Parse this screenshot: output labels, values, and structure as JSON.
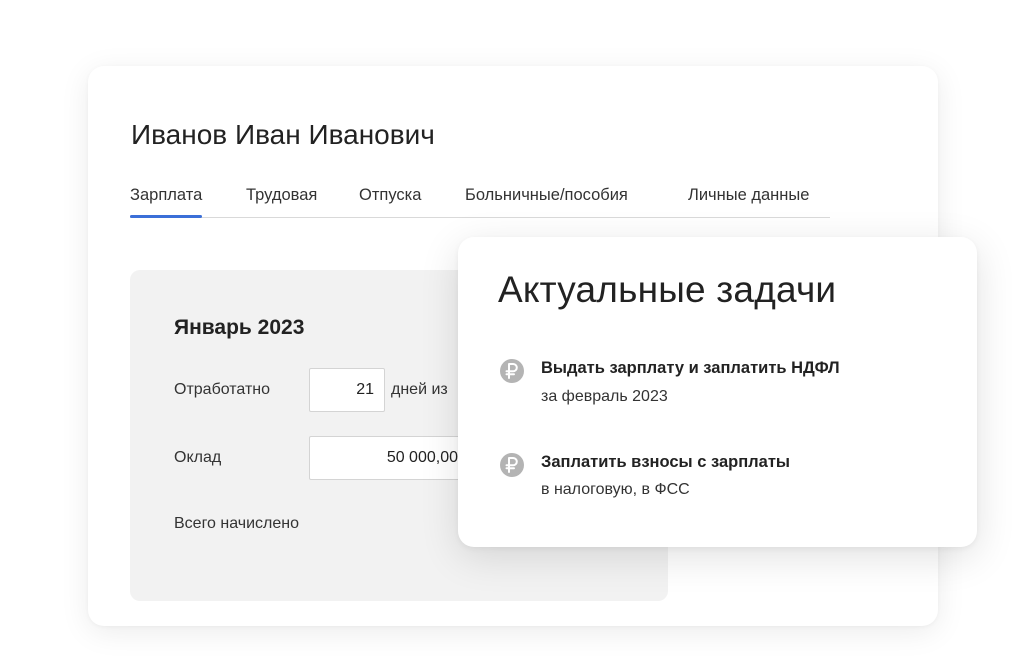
{
  "employee": {
    "name": "Иванов Иван Иванович"
  },
  "tabs": [
    {
      "label": "Зарплата",
      "active": true
    },
    {
      "label": "Трудовая",
      "active": false
    },
    {
      "label": "Отпуска",
      "active": false
    },
    {
      "label": "Больничные/пособия",
      "active": false
    },
    {
      "label": "Личные данные",
      "active": false
    }
  ],
  "salary_panel": {
    "month": "Январь 2023",
    "worked_label": "Отработатно",
    "worked_value": "21",
    "worked_suffix": "дней из",
    "salary_label": "Оклад",
    "salary_value": "50 000,00",
    "total_label": "Всего начислено"
  },
  "tasks_card": {
    "title": "Актуальные задачи",
    "items": [
      {
        "icon": "ruble-icon",
        "title": "Выдать зарплату и заплатить НДФЛ",
        "subtitle": "за февраль 2023"
      },
      {
        "icon": "ruble-icon",
        "title": "Заплатить взносы с зарплаты",
        "subtitle": "в налоговую, в ФСС"
      }
    ]
  },
  "colors": {
    "accent": "#3b6fd8",
    "panel_bg": "#f2f2f2",
    "icon_bg": "#b4b4b4"
  }
}
